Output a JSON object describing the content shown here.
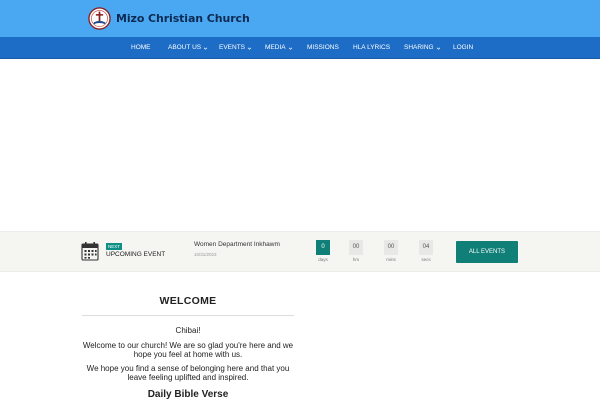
{
  "header": {
    "site_title": "Mizo Christian Church",
    "brand_color": "#4aa8f3",
    "logo_icon": "church-emblem-icon"
  },
  "nav": {
    "color": "#1d6cc5",
    "items": [
      {
        "label": "HOME",
        "dropdown": false
      },
      {
        "label": "ABOUT US",
        "dropdown": true
      },
      {
        "label": "EVENTS",
        "dropdown": true
      },
      {
        "label": "MEDIA",
        "dropdown": true
      },
      {
        "label": "MISSIONS",
        "dropdown": false
      },
      {
        "label": "HLA LYRICS",
        "dropdown": false
      },
      {
        "label": "SHARING",
        "dropdown": true
      },
      {
        "label": "LOGIN",
        "dropdown": false
      }
    ]
  },
  "events_bar": {
    "badge": "NEXT",
    "heading": "UPCOMING EVENT",
    "event_title": "Women Department Inkhawm",
    "event_date": "10/31/2023",
    "countdown": [
      {
        "value": "0",
        "label": "days"
      },
      {
        "value": "00",
        "label": "hrs"
      },
      {
        "value": "00",
        "label": "mins"
      },
      {
        "value": "04",
        "label": "secs"
      }
    ],
    "all_events_label": "ALL EVENTS",
    "accent_color": "#0f7f78",
    "calendar_icon": "calendar-icon"
  },
  "welcome": {
    "heading": "WELCOME",
    "greeting": "Chibai!",
    "paragraph_1": "Welcome to our church! We are so glad you're here and we hope you feel at home with us.",
    "paragraph_2": "We hope you find a sense of belonging here and that you leave feeling uplifted and inspired.",
    "verse_heading": "Daily Bible Verse"
  }
}
